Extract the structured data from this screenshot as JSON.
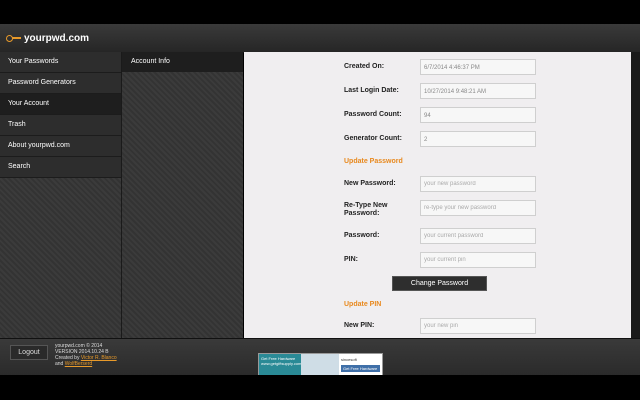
{
  "app": {
    "logo_text": "yourpwd.com"
  },
  "sidebar": {
    "items": [
      {
        "label": "Your Passwords"
      },
      {
        "label": "Password Generators"
      },
      {
        "label": "Your Account"
      },
      {
        "label": "Trash"
      },
      {
        "label": "About yourpwd.com"
      },
      {
        "label": "Search"
      }
    ],
    "active_index": 2
  },
  "subpanel": {
    "item": "Account Info"
  },
  "account": {
    "created_on_label": "Created On:",
    "created_on_value": "6/7/2014 4:46:37 PM",
    "last_login_label": "Last Login Date:",
    "last_login_value": "10/27/2014 9:48:21 AM",
    "password_count_label": "Password Count:",
    "password_count_value": "94",
    "generator_count_label": "Generator Count:",
    "generator_count_value": "2"
  },
  "update_password": {
    "heading": "Update Password",
    "new_label": "New Password:",
    "new_placeholder": "your new password",
    "retype_label": "Re-Type New Password:",
    "retype_placeholder": "re-type your new password",
    "current_label": "Password:",
    "current_placeholder": "your current password",
    "pin_label": "PIN:",
    "pin_placeholder": "your current pin",
    "button": "Change Password"
  },
  "update_pin": {
    "heading": "Update PIN",
    "new_label": "New PIN:",
    "new_placeholder": "your new pin"
  },
  "footer": {
    "logout": "Logout",
    "line1": "yourpwd.com © 2014",
    "line2": "VERSION 2014.10.24 B",
    "line3": "Created by",
    "author": "Victor R. Blanco",
    "line4": "and",
    "company": "WolfBerserd",
    "ad_left_title": "Get Free Hardware",
    "ad_left_sub": "www.getgiftsupply.com",
    "ad_right_brand": "sincesoft",
    "ad_right_cta": "Get Free Hardware"
  },
  "colors": {
    "accent": "#e8891e",
    "content_bg": "#f0eef0",
    "nav_bg": "#2d2d2d"
  }
}
